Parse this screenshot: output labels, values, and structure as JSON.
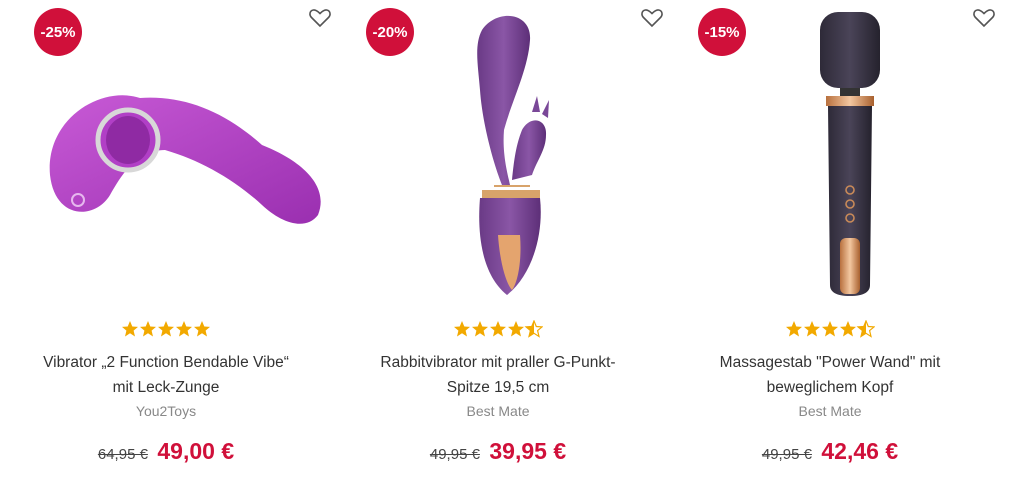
{
  "colors": {
    "accent": "#d0103a",
    "star": "#f2a900"
  },
  "products": [
    {
      "discount": "-25%",
      "rating": 5,
      "title_line1": "Vibrator „2 Function Bendable Vibe“",
      "title_line2": "mit Leck-Zunge",
      "brand": "You2Toys",
      "old_price": "64,95 €",
      "new_price": "49,00 €",
      "image_icon": "bendable-vibrator-image"
    },
    {
      "discount": "-20%",
      "rating": 4.5,
      "title_line1": "Rabbitvibrator mit praller G-Punkt-",
      "title_line2": "Spitze 19,5 cm",
      "brand": "Best Mate",
      "old_price": "49,95 €",
      "new_price": "39,95 €",
      "image_icon": "rabbit-vibrator-image"
    },
    {
      "discount": "-15%",
      "rating": 4.5,
      "title_line1": "Massagestab \"Power Wand\" mit",
      "title_line2": "beweglichem Kopf",
      "brand": "Best Mate",
      "old_price": "49,95 €",
      "new_price": "42,46 €",
      "image_icon": "wand-massager-image"
    }
  ]
}
